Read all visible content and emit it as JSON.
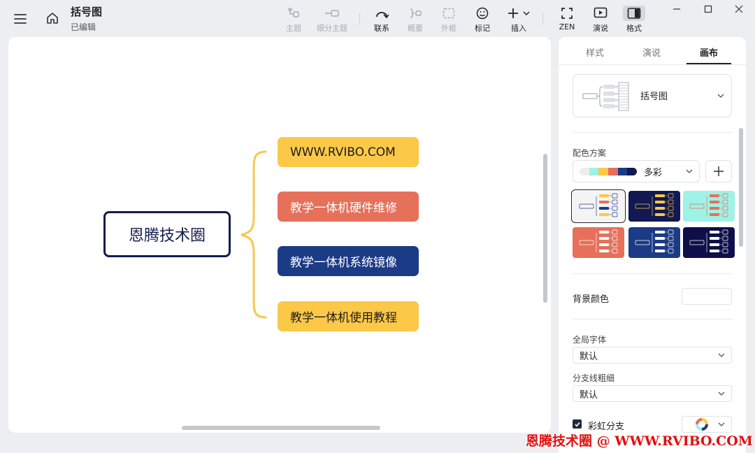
{
  "document": {
    "title": "括号图",
    "status": "已编辑"
  },
  "toolbar": {
    "topic": "主题",
    "subtopic": "细分主题",
    "relation": "联系",
    "summary": "概要",
    "boundary": "外框",
    "marker": "标记",
    "insert": "插入",
    "zen": "ZEN",
    "present": "演说",
    "format": "格式"
  },
  "mindmap": {
    "root": "恩腾技术圈",
    "branches": [
      {
        "label": "WWW.RVIBO.COM",
        "color": "#fcc848",
        "text_color": "#1c1c1c"
      },
      {
        "label": "教学一体机硬件维修",
        "color": "#e6705a",
        "text_color": "#ffffff"
      },
      {
        "label": "教学一体机系统镜像",
        "color": "#1c3b86",
        "text_color": "#ffffff"
      },
      {
        "label": "教学一体机使用教程",
        "color": "#fcc848",
        "text_color": "#1c1c1c"
      }
    ],
    "brace_color": "#f7c84a"
  },
  "panel": {
    "tabs": [
      "样式",
      "演说",
      "画布"
    ],
    "active_tab": "画布",
    "structure": "括号图",
    "color_scheme_label": "配色方案",
    "color_scheme": "多彩",
    "color_scheme_swatches": [
      "#eeeeee",
      "#9ef2e6",
      "#fcc848",
      "#e6705a",
      "#1c3b86",
      "#121852"
    ],
    "themes": [
      {
        "bg": "#f4f4f4",
        "accent": "#1c3b86"
      },
      {
        "bg": "#121852",
        "accent": "#fcc848"
      },
      {
        "bg": "#9ef2e6",
        "accent": "#e6705a"
      },
      {
        "bg": "#e6705a",
        "accent": "#ffffff"
      },
      {
        "bg": "#1c3b86",
        "accent": "#ffffff"
      },
      {
        "bg": "#0e0f4a",
        "accent": "#ffffff"
      }
    ],
    "background_color_label": "背景颜色",
    "global_font_label": "全局字体",
    "global_font": "默认",
    "branch_width_label": "分支线粗细",
    "branch_width": "默认",
    "rainbow_branch_label": "彩虹分支"
  },
  "watermark": "恩腾技术圈 @ WWW.RVIBO.COM"
}
